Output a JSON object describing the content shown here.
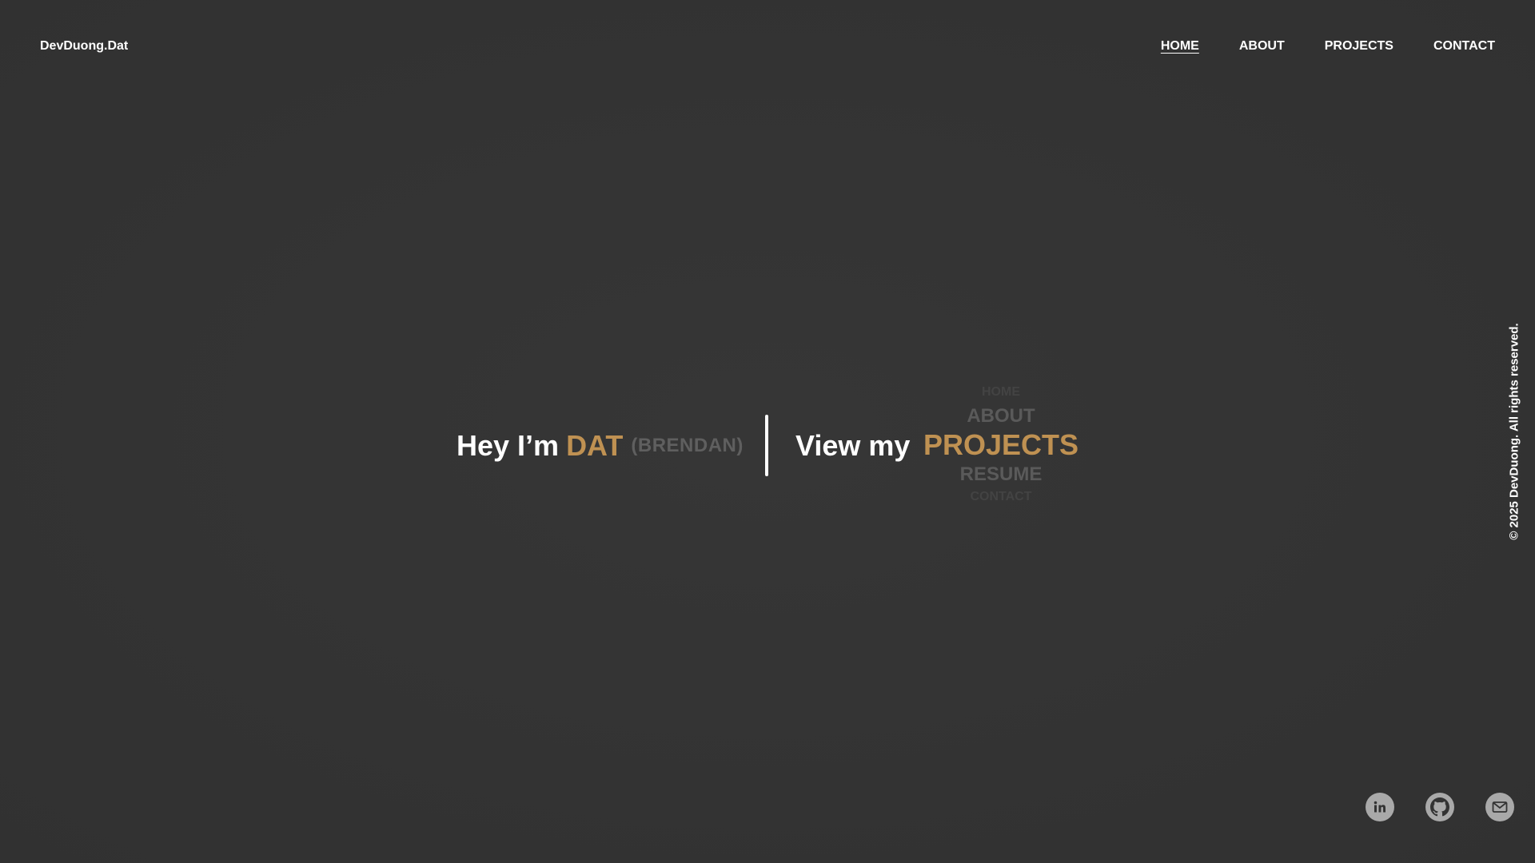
{
  "header": {
    "brand": "DevDuong.Dat",
    "nav": [
      {
        "label": "HOME",
        "active": true
      },
      {
        "label": "ABOUT",
        "active": false
      },
      {
        "label": "PROJECTS",
        "active": false
      },
      {
        "label": "CONTACT",
        "active": false
      }
    ]
  },
  "hero": {
    "greeting": "Hey I’m",
    "name": "DAT",
    "nickname": "(BRENDAN)",
    "view_label": "View my",
    "wheel": [
      "HOME",
      "ABOUT",
      "PROJECTS",
      "RESUME",
      "CONTACT"
    ],
    "wheel_selected": "PROJECTS"
  },
  "copyright": "© 2025 DevDuong. All rights reserved.",
  "socials": [
    {
      "icon": "linkedin-icon"
    },
    {
      "icon": "github-icon"
    },
    {
      "icon": "email-icon"
    }
  ],
  "colors": {
    "background": "#333333",
    "accent": "#bf9152",
    "text": "#ffffff",
    "muted": "#5f5f5f"
  }
}
